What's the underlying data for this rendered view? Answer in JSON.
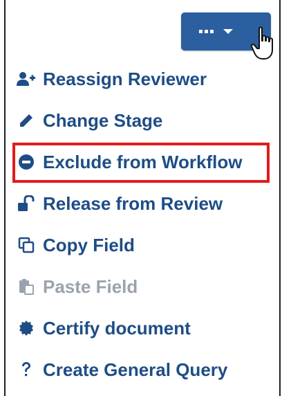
{
  "toolbar": {
    "menu_button": {
      "icon": "ellipsis-icon",
      "caret_icon": "chevron-down-icon",
      "background": "#2b5fa0"
    }
  },
  "menu": {
    "items": [
      {
        "label": "Reassign Reviewer",
        "icon": "user-plus-icon",
        "enabled": true
      },
      {
        "label": "Change Stage",
        "icon": "pencil-icon",
        "enabled": true
      },
      {
        "label": "Exclude from Workflow",
        "icon": "minus-circle-icon",
        "enabled": true,
        "highlighted": true
      },
      {
        "label": "Release from Review",
        "icon": "unlock-icon",
        "enabled": true
      },
      {
        "label": "Copy Field",
        "icon": "copy-icon",
        "enabled": true
      },
      {
        "label": "Paste Field",
        "icon": "paste-icon",
        "enabled": false
      },
      {
        "label": "Certify document",
        "icon": "certificate-icon",
        "enabled": true
      },
      {
        "label": "Create General Query",
        "icon": "question-icon",
        "enabled": true
      }
    ]
  },
  "colors": {
    "link": "#1e4d86",
    "disabled": "#9aa3ad",
    "highlight_border": "#e11b1b"
  }
}
